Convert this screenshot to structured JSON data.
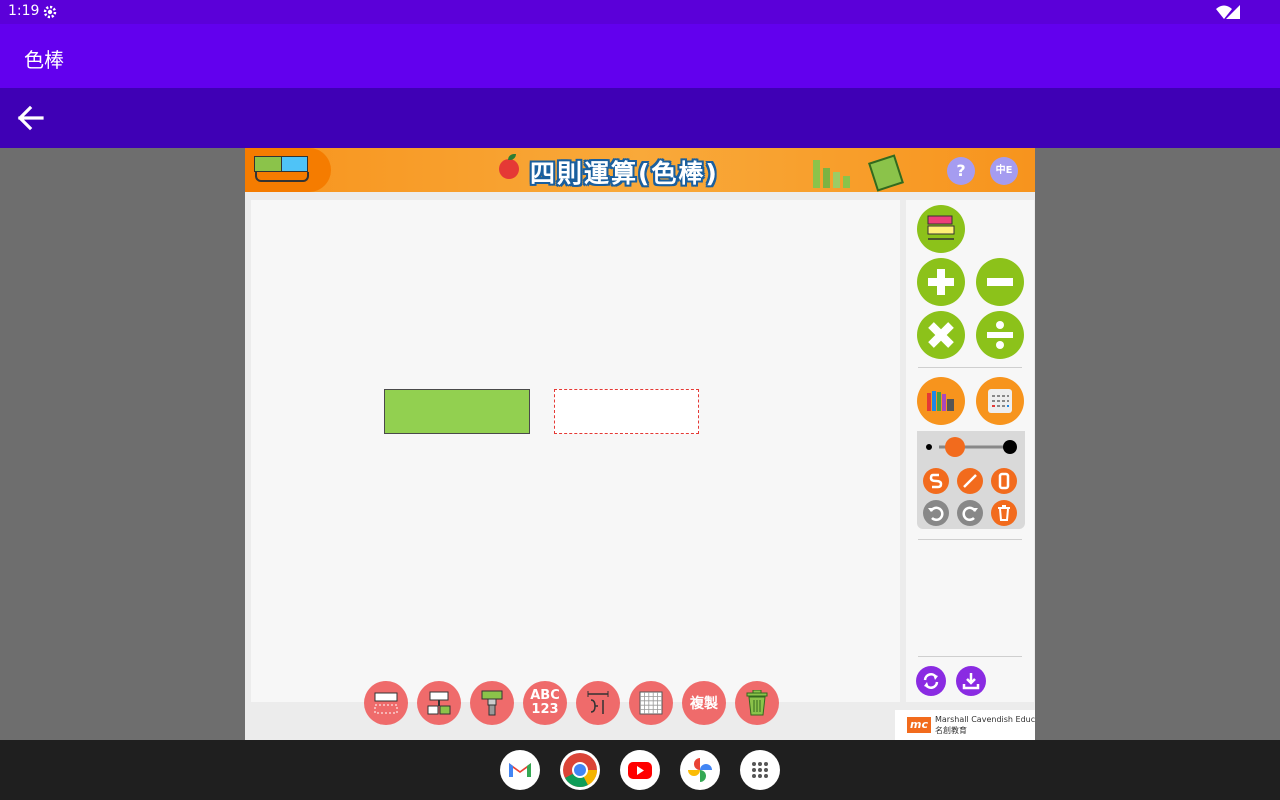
{
  "status_bar": {
    "time": "1:19"
  },
  "app_bar": {
    "title": "色棒"
  },
  "banner": {
    "heading": "四則運算(色棒)",
    "help_label": "?",
    "lang_label": "中E"
  },
  "toolbar": {
    "abc_label": "ABC",
    "num_label": "123",
    "copy_label": "複製"
  },
  "brand": {
    "mc": "mc",
    "line1": "Marshall Cavendish Education",
    "line2": "名創教育"
  },
  "colors": {
    "accent": "#6200ee",
    "status": "#5b00d9",
    "nav": "#3f00b5",
    "orange": "#f7941d",
    "green": "#8cc21a",
    "coral": "#ef6b6b"
  },
  "dock": [
    "gmail-icon",
    "chrome-icon",
    "youtube-icon",
    "photos-icon",
    "app-drawer-icon"
  ]
}
